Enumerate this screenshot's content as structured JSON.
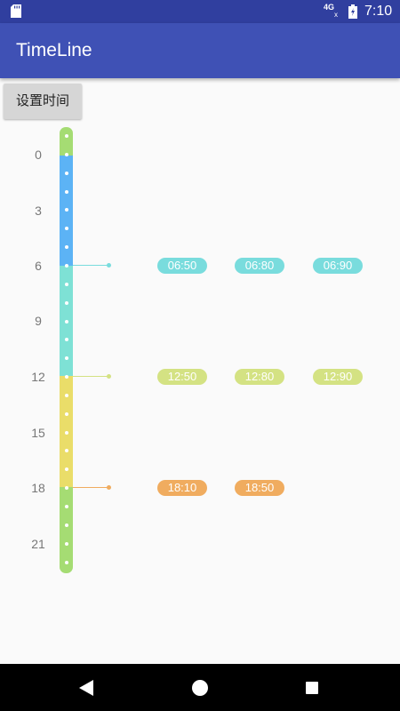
{
  "status_bar": {
    "network": "4G",
    "network_sub": "x",
    "time": "7:10",
    "icons": [
      "sd-card-icon",
      "signal-icon",
      "battery-icon"
    ]
  },
  "app_bar": {
    "title": "TimeLine"
  },
  "set_time_button": {
    "label": "设置时间"
  },
  "timeline": {
    "hour_labels": [
      "0",
      "3",
      "6",
      "9",
      "12",
      "15",
      "18",
      "21"
    ],
    "segments": [
      {
        "color": "#a5dc73"
      },
      {
        "color": "#5cb3f5"
      },
      {
        "color": "#7ee1d5"
      },
      {
        "color": "#eadd69"
      },
      {
        "color": "#a5dc73"
      }
    ],
    "rows": [
      {
        "hour": "6",
        "color": "#79dcdd",
        "times": [
          "06:50",
          "06:80",
          "06:90"
        ]
      },
      {
        "hour": "12",
        "color": "#d4e283",
        "times": [
          "12:50",
          "12:80",
          "12:90"
        ]
      },
      {
        "hour": "18",
        "color": "#f0ac5f",
        "times": [
          "18:10",
          "18:50"
        ]
      }
    ]
  },
  "nav_bar": {
    "icons": [
      "back-icon",
      "home-icon",
      "recents-icon"
    ]
  }
}
